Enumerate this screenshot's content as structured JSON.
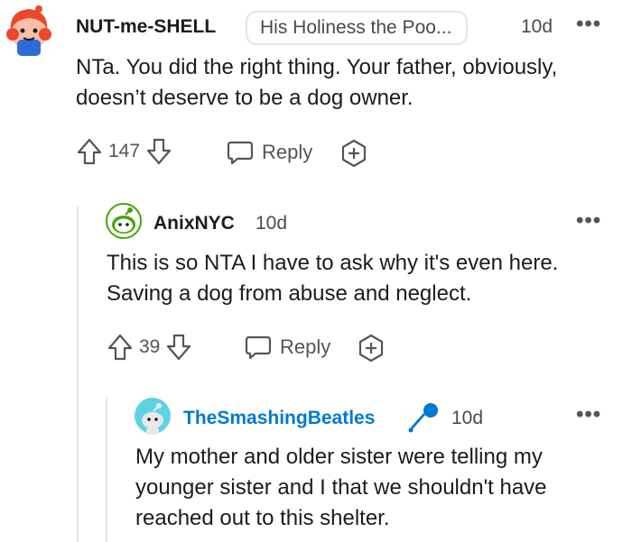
{
  "comments": [
    {
      "username": "NUT-me-SHELL",
      "flair": "His Holiness the Poo...",
      "time": "10d",
      "body": "NTa. You did the right thing. Your father, obviously, doesn’t deserve to be a dog owner.",
      "votes": "147",
      "reply_label": "Reply"
    },
    {
      "username": "AnixNYC",
      "time": "10d",
      "body": "This is so NTA I have to ask why it's even here. Saving a dog from abuse and neglect.",
      "votes": "39",
      "reply_label": "Reply"
    },
    {
      "username": "TheSmashingBeatles",
      "time": "10d",
      "body": "My mother and older sister were telling my younger sister and I that we shouldn't have reached out to this shelter."
    }
  ],
  "more_label": "•••",
  "colors": {
    "accent_blue": "#0079d3",
    "meta_gray": "#4a4a4a"
  }
}
